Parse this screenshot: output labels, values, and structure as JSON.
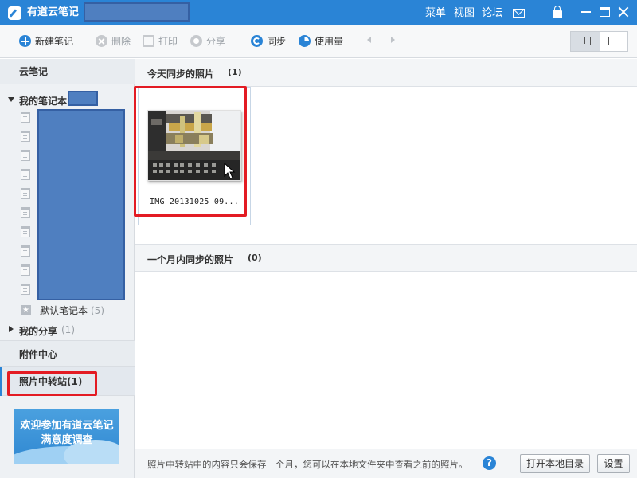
{
  "window": {
    "app_title": "有道云笔记",
    "menu": [
      "菜单",
      "视图",
      "论坛"
    ],
    "icons": [
      "mail-icon",
      "lock-icon",
      "minimize-icon",
      "maximize-icon",
      "close-icon"
    ]
  },
  "toolbar": {
    "new_note": "新建笔记",
    "delete": "删除",
    "print": "打印",
    "share": "分享",
    "sync": "同步",
    "usage": "使用量"
  },
  "sidebar": {
    "cloud_notes": "云笔记",
    "my_notebooks": "我的笔记本",
    "default_notebook": {
      "label": "默认笔记本",
      "count": "(5)"
    },
    "my_share": {
      "label": "我的分享",
      "count": "(1)"
    },
    "attachment_center": "附件中心",
    "photo_station": "照片中转站(1)",
    "promo": {
      "line1": "欢迎参加有道云笔记",
      "line2": "满意度调查"
    }
  },
  "main": {
    "today": {
      "title": "今天同步的照片",
      "count": "(1)"
    },
    "photos": [
      {
        "filename": "IMG_20131025_09..."
      }
    ],
    "month": {
      "title": "一个月内同步的照片",
      "count": "(0)"
    }
  },
  "footer": {
    "note": "照片中转站中的内容只会保存一个月，您可以在本地文件夹中查看之前的照片。",
    "help": "?",
    "open_folder": "打开本地目录",
    "settings": "设置"
  },
  "colors": {
    "accent": "#2a84d6",
    "highlight_box": "#e31b23",
    "redaction": "#4f7fc0"
  }
}
